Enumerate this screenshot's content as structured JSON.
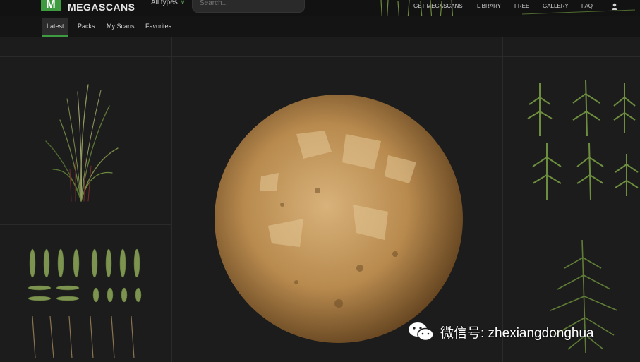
{
  "header": {
    "logo_letter": "M",
    "brand": "MEGASCANS",
    "type_filter": "All types",
    "search_placeholder": "Search...",
    "nav": [
      "GET MEGASCANS",
      "LIBRARY",
      "FREE",
      "GALLERY",
      "FAQ"
    ]
  },
  "tabs": [
    "Latest",
    "Packs",
    "My Scans",
    "Favorites"
  ],
  "active_tab": "Latest",
  "colors": {
    "accent": "#3f9b3f",
    "sphere": "#b88a4e",
    "foliage": "#4a6b2a"
  },
  "icons": [
    "chevron-down-icon",
    "user-icon",
    "wechat-icon"
  ],
  "watermark": "微信号: zhexiangdonghua"
}
